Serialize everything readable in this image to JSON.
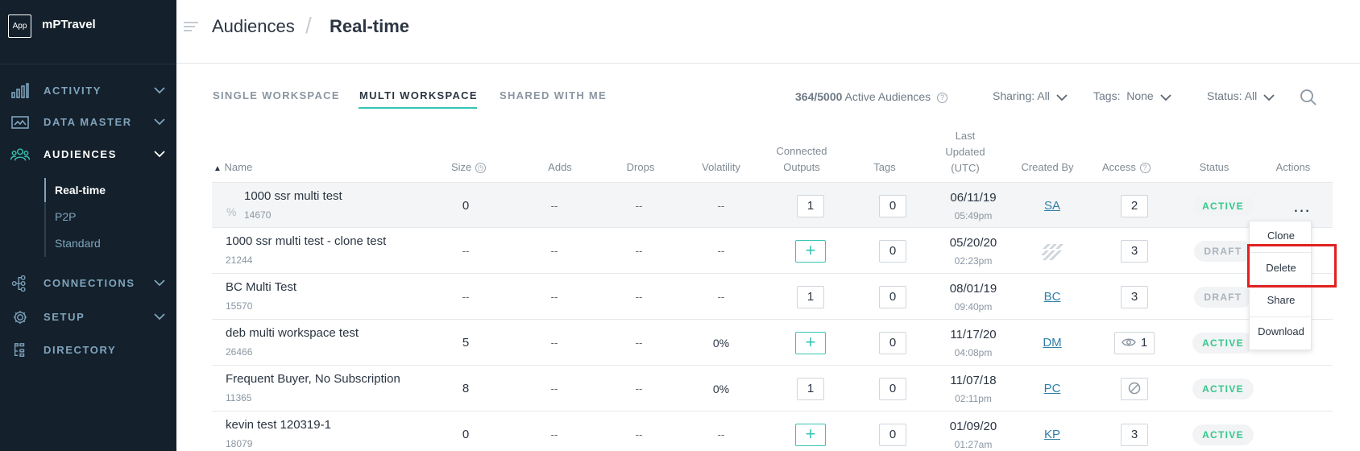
{
  "app": {
    "logo_text": "App",
    "name": "mPTravel"
  },
  "sidebar": {
    "items": [
      {
        "label": "ACTIVITY",
        "icon": "bar-chart-icon"
      },
      {
        "label": "DATA MASTER",
        "icon": "data-card-icon"
      },
      {
        "label": "AUDIENCES",
        "icon": "people-icon",
        "active": true
      },
      {
        "label": "CONNECTIONS",
        "icon": "connections-icon"
      },
      {
        "label": "SETUP",
        "icon": "gear-icon"
      },
      {
        "label": "DIRECTORY",
        "icon": "directory-icon"
      }
    ],
    "audiences_sub": [
      "Real-time",
      "P2P",
      "Standard"
    ]
  },
  "header": {
    "crumb_parent": "Audiences",
    "crumb_current": "Real-time"
  },
  "tabs": [
    "SINGLE WORKSPACE",
    "MULTI WORKSPACE",
    "SHARED WITH ME"
  ],
  "filters": {
    "quota_count": "364/5000",
    "quota_label": "Active Audiences",
    "sharing_label": "Sharing:",
    "sharing_value": "All",
    "tags_label": "Tags:",
    "tags_value": "None",
    "status_label": "Status:",
    "status_value": "All"
  },
  "columns": {
    "name": "Name",
    "size": "Size",
    "adds": "Adds",
    "drops": "Drops",
    "volatility": "Volatility",
    "connected_1": "Connected",
    "connected_2": "Outputs",
    "tags": "Tags",
    "updated_1": "Last",
    "updated_2": "Updated",
    "updated_3": "(UTC)",
    "created_by": "Created By",
    "access": "Access",
    "status": "Status",
    "actions": "Actions"
  },
  "rows": [
    {
      "name": "1000 ssr multi test",
      "id": "14670",
      "size": "0",
      "adds": "--",
      "drops": "--",
      "volatility": "--",
      "outputs": "1",
      "tags": "0",
      "date": "06/11/19",
      "time": "05:49pm",
      "created_by": "SA",
      "access": "2",
      "status": "ACTIVE"
    },
    {
      "name": "1000 ssr multi test - clone test",
      "id": "21244",
      "size": "--",
      "adds": "--",
      "drops": "--",
      "volatility": "--",
      "outputs": "+",
      "tags": "0",
      "date": "05/20/20",
      "time": "02:23pm",
      "created_by": "",
      "access": "3",
      "status": "DRAFT"
    },
    {
      "name": "BC Multi Test",
      "id": "15570",
      "size": "--",
      "adds": "--",
      "drops": "--",
      "volatility": "--",
      "outputs": "1",
      "tags": "0",
      "date": "08/01/19",
      "time": "09:40pm",
      "created_by": "BC",
      "access": "3",
      "status": "DRAFT"
    },
    {
      "name": "deb multi workspace test",
      "id": "26466",
      "size": "5",
      "adds": "--",
      "drops": "--",
      "volatility": "0%",
      "outputs": "+",
      "tags": "0",
      "date": "11/17/20",
      "time": "04:08pm",
      "created_by": "DM",
      "access": "1",
      "status": "ACTIVE"
    },
    {
      "name": "Frequent Buyer, No Subscription",
      "id": "11365",
      "size": "8",
      "adds": "--",
      "drops": "--",
      "volatility": "0%",
      "outputs": "1",
      "tags": "0",
      "date": "11/07/18",
      "time": "02:11pm",
      "created_by": "PC",
      "access": "",
      "status": "ACTIVE"
    },
    {
      "name": "kevin test 120319-1",
      "id": "18079",
      "size": "0",
      "adds": "--",
      "drops": "--",
      "volatility": "--",
      "outputs": "+",
      "tags": "0",
      "date": "01/09/20",
      "time": "01:27am",
      "created_by": "KP",
      "access": "3",
      "status": "ACTIVE"
    }
  ],
  "actions_menu": {
    "trigger": "...",
    "items": [
      "Clone",
      "Delete",
      "Share",
      "Download"
    ]
  },
  "colors": {
    "sidebar_bg": "#14202b",
    "accent": "#36c5b5",
    "active_status": "#34c88a",
    "highlight": "#e02020"
  }
}
